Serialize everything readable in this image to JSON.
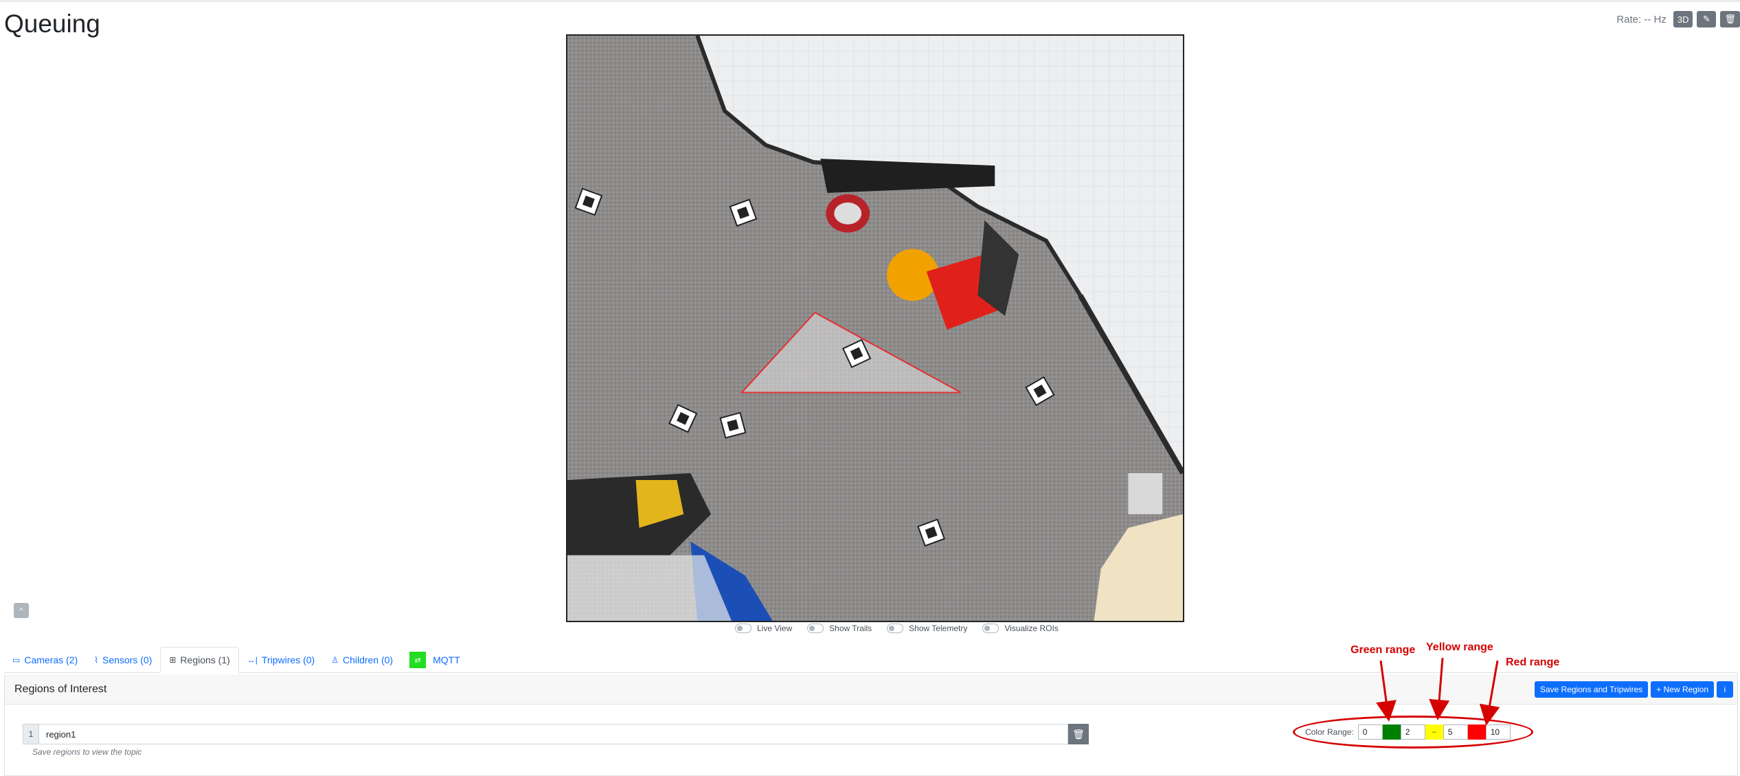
{
  "page": {
    "title": "Queuing",
    "rate_text": "Rate: -- Hz",
    "btn_3d": "3D",
    "pencil_glyph": "✎",
    "trash_glyph": "🗑"
  },
  "collapse_glyph": "^",
  "toggles": [
    {
      "label": "Live View"
    },
    {
      "label": "Show Trails"
    },
    {
      "label": "Show Telemetry"
    },
    {
      "label": "Visualize ROIs"
    }
  ],
  "tabs": [
    {
      "icon": "camera-icon",
      "glyph": "▭",
      "label": "Cameras (2)"
    },
    {
      "icon": "sensor-icon",
      "glyph": "⌇",
      "label": "Sensors (0)"
    },
    {
      "icon": "region-icon",
      "glyph": "⊞",
      "label": "Regions (1)",
      "active": true
    },
    {
      "icon": "tripwire-icon",
      "glyph": "↔|",
      "label": "Tripwires (0)"
    },
    {
      "icon": "children-icon",
      "glyph": "♙",
      "label": "Children (0)"
    },
    {
      "icon": "mqtt-status-icon",
      "glyph": "⇄",
      "label": "MQTT"
    }
  ],
  "card": {
    "title": "Regions of Interest",
    "save_button": "Save Regions and Tripwires",
    "new_region_button": "+ New Region",
    "info_glyph": "i"
  },
  "region": {
    "number": "1",
    "name": "region1",
    "hint": "Save regions to view the topic",
    "delete_glyph": "🗑"
  },
  "color_range": {
    "label": "Color Range:",
    "min": "0",
    "green_max": "2",
    "yellow_marker": "--",
    "yellow_max": "5",
    "red_max": "10",
    "green": "#008000",
    "yellow": "#ffff00",
    "red": "#ff0000"
  },
  "annotations": {
    "green": "Green range",
    "yellow": "Yellow range",
    "red": "Red range",
    "color": "#d50000"
  }
}
